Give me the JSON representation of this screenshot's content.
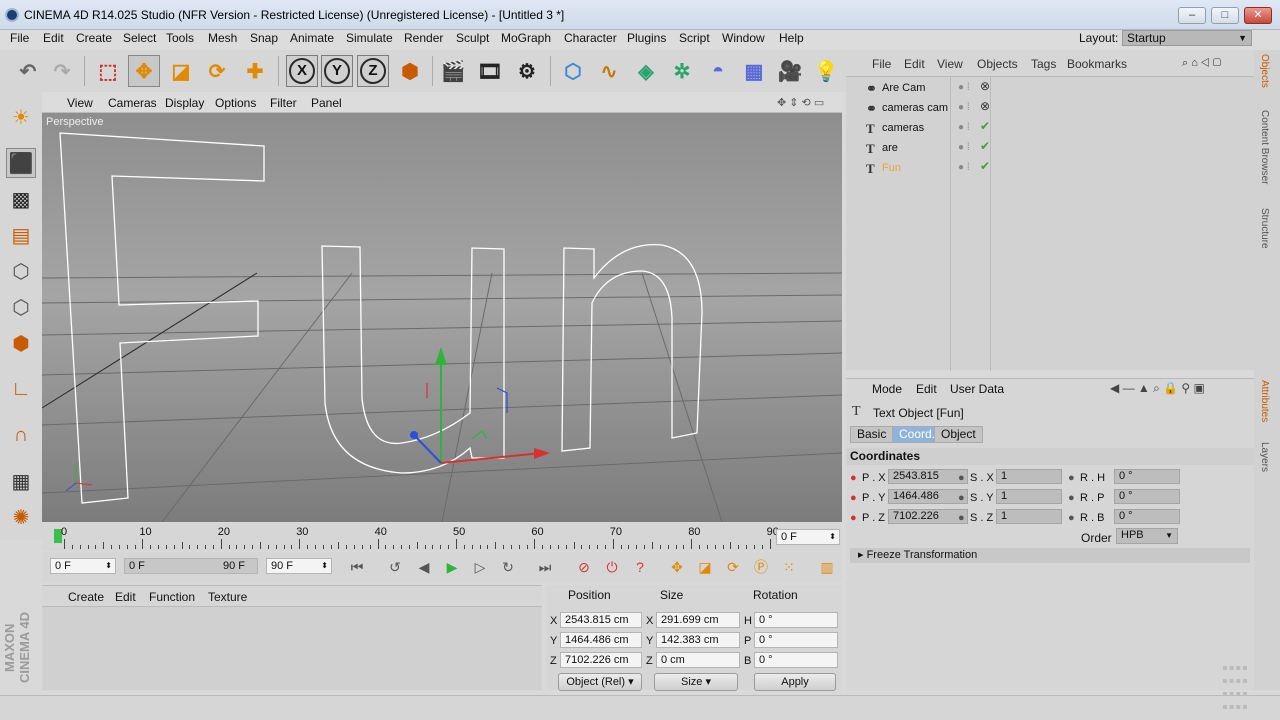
{
  "window": {
    "title": "CINEMA 4D R14.025 Studio (NFR Version - Restricted License) (Unregistered License) - [Untitled 3 *]"
  },
  "menu": [
    "File",
    "Edit",
    "Create",
    "Select",
    "Tools",
    "Mesh",
    "Snap",
    "Animate",
    "Simulate",
    "Render",
    "Sculpt",
    "MoGraph",
    "Character",
    "Plugins",
    "Script",
    "Window",
    "Help"
  ],
  "layout": {
    "label": "Layout:",
    "value": "Startup"
  },
  "viewport": {
    "menu": [
      "View",
      "Cameras",
      "Display",
      "Options",
      "Filter",
      "Panel"
    ],
    "label": "Perspective",
    "text3d": "Fun"
  },
  "timeline": {
    "ticks": [
      "0",
      "10",
      "20",
      "30",
      "40",
      "50",
      "60",
      "70",
      "80",
      "90"
    ],
    "current_frame": "0 F"
  },
  "transport": {
    "start": "0 F",
    "range_start": "0 F",
    "range_end": "90 F",
    "end": "90 F"
  },
  "material": {
    "menu": [
      "Create",
      "Edit",
      "Function",
      "Texture"
    ]
  },
  "coords": {
    "headers": [
      "Position",
      "Size",
      "Rotation"
    ],
    "rows": [
      {
        "axis": "X",
        "pos": "2543.815 cm",
        "size_axis": "X",
        "size": "291.699 cm",
        "rot_axis": "H",
        "rot": "0 °"
      },
      {
        "axis": "Y",
        "pos": "1464.486 cm",
        "size_axis": "Y",
        "size": "142.383 cm",
        "rot_axis": "P",
        "rot": "0 °"
      },
      {
        "axis": "Z",
        "pos": "7102.226 cm",
        "size_axis": "Z",
        "size": "0 cm",
        "rot_axis": "B",
        "rot": "0 °"
      }
    ],
    "mode": "Object (Rel)",
    "size_mode": "Size",
    "apply": "Apply"
  },
  "objects": {
    "menu": [
      "File",
      "Edit",
      "View",
      "Objects",
      "Tags",
      "Bookmarks"
    ],
    "items": [
      {
        "name": "Are Cam",
        "icon": "camera-icon"
      },
      {
        "name": "cameras cam",
        "icon": "camera-icon"
      },
      {
        "name": "cameras",
        "icon": "text-icon"
      },
      {
        "name": "are",
        "icon": "text-icon"
      },
      {
        "name": "Fun",
        "icon": "text-icon",
        "selected": true
      }
    ]
  },
  "attributes": {
    "menu": [
      "Mode",
      "Edit",
      "User Data"
    ],
    "object_title": "Text Object [Fun]",
    "tabs": [
      "Basic",
      "Coord.",
      "Object"
    ],
    "active_tab": "Coord.",
    "section": "Coordinates",
    "p": [
      {
        "label": "P . X",
        "value": "2543.815"
      },
      {
        "label": "P . Y",
        "value": "1464.486"
      },
      {
        "label": "P . Z",
        "value": "7102.226"
      }
    ],
    "s": [
      {
        "label": "S . X",
        "value": "1"
      },
      {
        "label": "S . Y",
        "value": "1"
      },
      {
        "label": "S . Z",
        "value": "1"
      }
    ],
    "r": [
      {
        "label": "R . H",
        "value": "0 °"
      },
      {
        "label": "R . P",
        "value": "0 °"
      },
      {
        "label": "R . B",
        "value": "0 °"
      }
    ],
    "order_label": "Order",
    "order_value": "HPB",
    "freeze": "Freeze Transformation"
  },
  "sidebar_tabs": [
    "Objects",
    "Content Browser",
    "Structure",
    "Attributes",
    "Layers"
  ],
  "logo": "MAXON CINEMA 4D",
  "colors": {
    "accent": "#8fb3dc",
    "selected_object": "#e8a53a",
    "x_axis": "#d93030",
    "y_axis": "#2fb43a",
    "z_axis": "#2a4fd9"
  }
}
